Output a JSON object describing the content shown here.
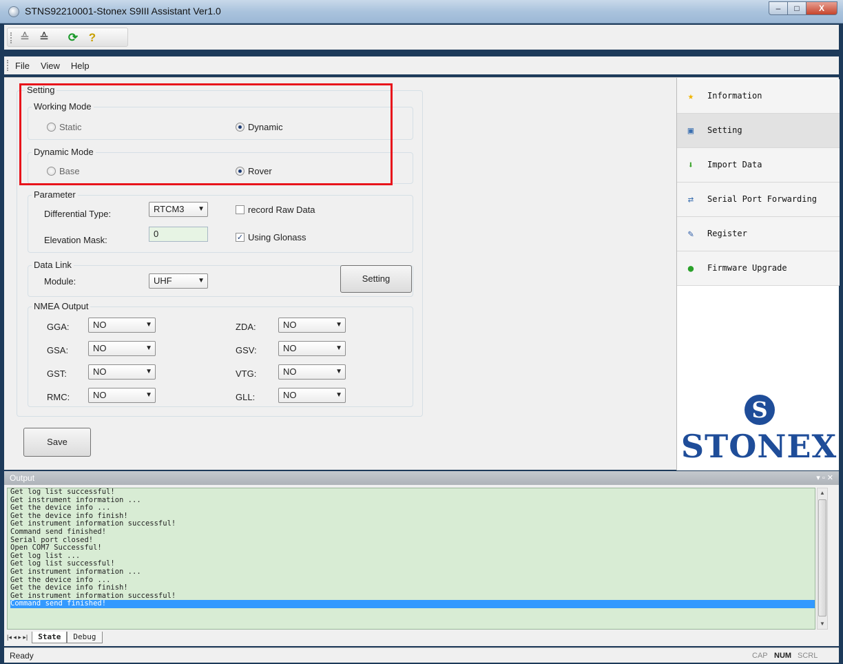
{
  "window": {
    "title": "STNS92210001-Stonex S9III Assistant Ver1.0",
    "minimize": "–",
    "maximize": "□",
    "close": "X"
  },
  "toolbar": {
    "icons": [
      "connect-icon",
      "disconnect-icon",
      "refresh-icon",
      "help-icon"
    ]
  },
  "menu": [
    "File",
    "View",
    "Help"
  ],
  "setting": {
    "group_title": "Setting",
    "working_mode": {
      "title": "Working Mode",
      "static_label": "Static",
      "dynamic_label": "Dynamic",
      "selected": "Dynamic"
    },
    "dynamic_mode": {
      "title": "Dynamic Mode",
      "base_label": "Base",
      "rover_label": "Rover",
      "selected": "Rover"
    },
    "parameter": {
      "title": "Parameter",
      "diff_type_label": "Differential Type:",
      "diff_type_value": "RTCM3",
      "record_raw_label": "record Raw Data",
      "record_raw_checked": false,
      "elevation_label": "Elevation Mask:",
      "elevation_value": "0",
      "glonass_label": "Using Glonass",
      "glonass_checked": true
    },
    "data_link": {
      "title": "Data Link",
      "module_label": "Module:",
      "module_value": "UHF",
      "setting_button": "Setting"
    },
    "nmea": {
      "title": "NMEA Output",
      "left": [
        {
          "label": "GGA:",
          "value": "NO"
        },
        {
          "label": "GSA:",
          "value": "NO"
        },
        {
          "label": "GST:",
          "value": "NO"
        },
        {
          "label": "RMC:",
          "value": "NO"
        }
      ],
      "right": [
        {
          "label": "ZDA:",
          "value": "NO"
        },
        {
          "label": "GSV:",
          "value": "NO"
        },
        {
          "label": "VTG:",
          "value": "NO"
        },
        {
          "label": "GLL:",
          "value": "NO"
        }
      ]
    },
    "save_button": "Save"
  },
  "nav": {
    "items": [
      {
        "label": "Information",
        "icon": "star-icon"
      },
      {
        "label": "Setting",
        "icon": "settings-icon"
      },
      {
        "label": "Import Data",
        "icon": "download-arrow-icon"
      },
      {
        "label": "Serial Port Forwarding",
        "icon": "serial-port-icon"
      },
      {
        "label": "Register",
        "icon": "register-icon"
      },
      {
        "label": "Firmware Upgrade",
        "icon": "upgrade-icon"
      }
    ],
    "selected": "Setting",
    "brand": "STONEX"
  },
  "output": {
    "title": "Output",
    "controls": "▾ ▫ ✕",
    "lines": [
      "Get log list successful!",
      "Get instrument information ...",
      "Get the device info ...",
      "Get the device info finish!",
      "Get instrument information successful!",
      "Command send finished!",
      "Serial port closed!",
      "Open COM7 Successful!",
      "Get log list ...",
      "Get log list successful!",
      "Get instrument information ...",
      "Get the device info ...",
      "Get the device info finish!",
      "Get instrument information successful!",
      "Command send finished!"
    ],
    "selected_line": 14,
    "tab_nav": "|◂ ◂ ▸ ▸|",
    "tabs": [
      "State",
      "Debug"
    ],
    "active_tab": "State"
  },
  "status": {
    "text": "Ready",
    "cap": "CAP",
    "num": "NUM",
    "scrl": "SCRL"
  }
}
